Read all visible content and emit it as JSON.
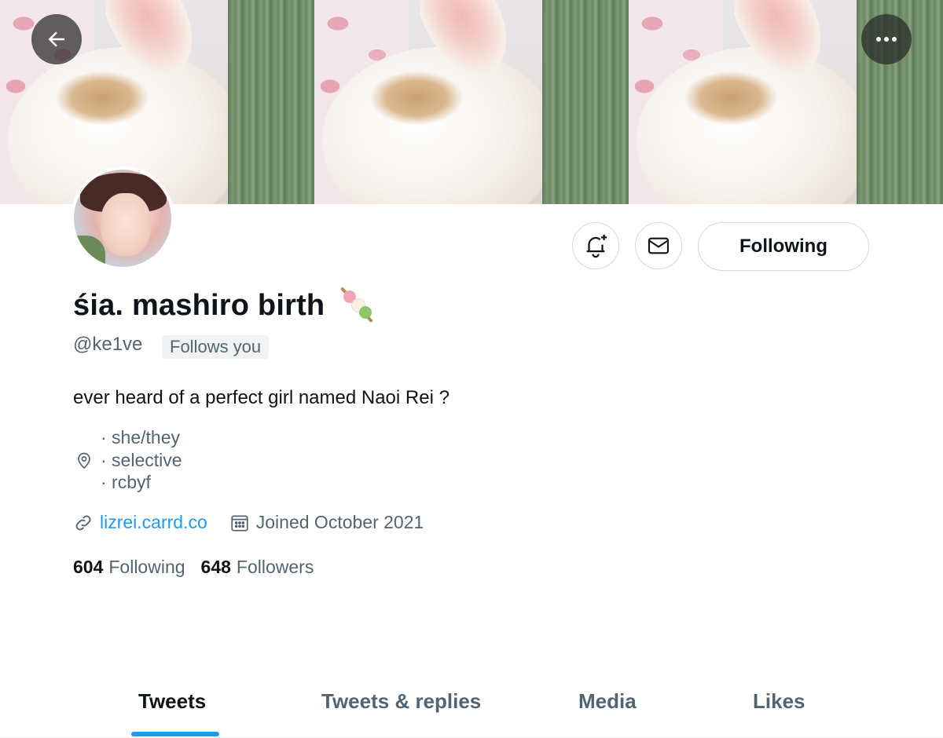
{
  "header": {
    "back_icon": "arrow-left-icon",
    "more_icon": "ellipsis-icon"
  },
  "profile": {
    "display_name": "śia. mashiro birth",
    "name_emoji": "dango-emoji",
    "handle": "@ke1ve",
    "follows_you_badge": "Follows you",
    "bio": "ever heard of a perfect girl named Naoi Rei ?",
    "location_lines": [
      "· she/they",
      "· selective",
      "· rcbyf"
    ],
    "website": "lizrei.carrd.co",
    "joined": "Joined October 2021",
    "following_count": "604",
    "following_label": "Following",
    "followers_count": "648",
    "followers_label": "Followers"
  },
  "actions": {
    "notify_icon": "bell-plus-icon",
    "message_icon": "envelope-icon",
    "follow_button_label": "Following"
  },
  "tabs": [
    {
      "label": "Tweets",
      "active": true
    },
    {
      "label": "Tweets & replies",
      "active": false
    },
    {
      "label": "Media",
      "active": false
    },
    {
      "label": "Likes",
      "active": false
    }
  ],
  "colors": {
    "accent": "#1d9bf0",
    "text_primary": "#0f1419",
    "text_secondary": "#536471",
    "border": "#cfd9de"
  }
}
